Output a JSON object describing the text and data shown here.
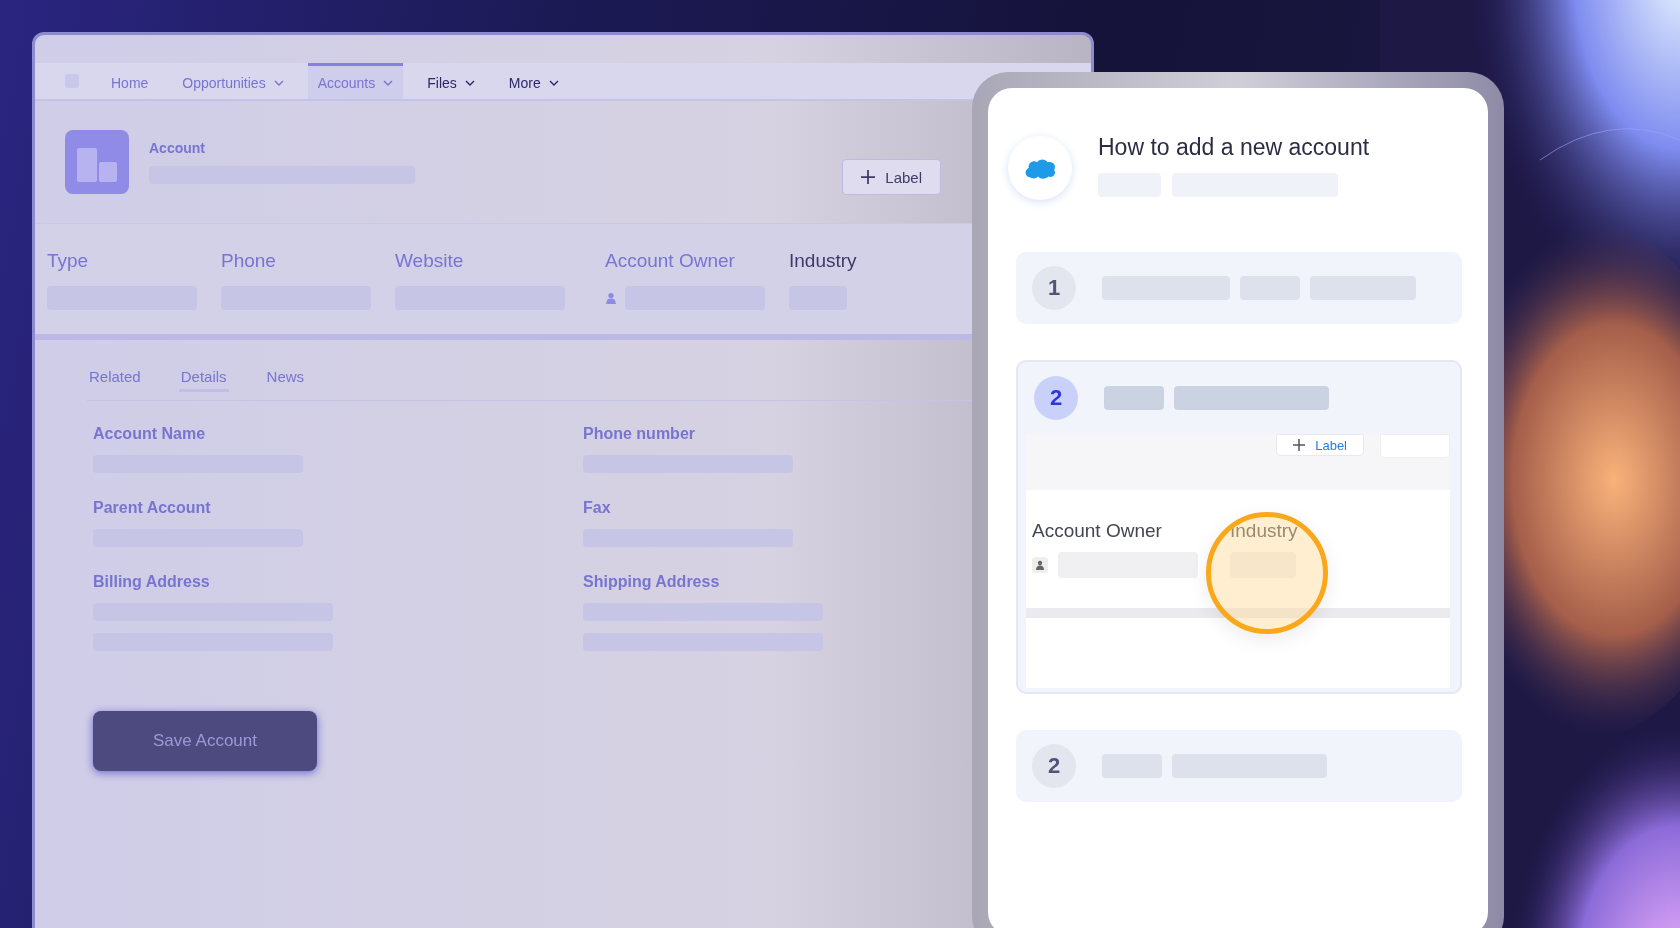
{
  "app_window": {
    "nav_tabs": [
      {
        "label": "Home",
        "selected": false,
        "dropdown": false,
        "faded": true
      },
      {
        "label": "Opportunities",
        "selected": false,
        "dropdown": true,
        "faded": true
      },
      {
        "label": "Accounts",
        "selected": true,
        "dropdown": true,
        "faded": true
      },
      {
        "label": "Files",
        "selected": false,
        "dropdown": true,
        "faded": false
      },
      {
        "label": "More",
        "selected": false,
        "dropdown": true,
        "faded": false
      }
    ],
    "record_type": "Account",
    "header_button": "Label",
    "highlight_fields": [
      {
        "label": "Type",
        "kind": "text",
        "faded": true
      },
      {
        "label": "Phone",
        "kind": "text",
        "faded": true
      },
      {
        "label": "Website",
        "kind": "text",
        "faded": true
      },
      {
        "label": "Account Owner",
        "kind": "user",
        "faded": true
      },
      {
        "label": "Industry",
        "kind": "short",
        "faded": false
      }
    ],
    "detail_tabs": [
      {
        "label": "Related",
        "selected": false
      },
      {
        "label": "Details",
        "selected": true
      },
      {
        "label": "News",
        "selected": false
      }
    ],
    "detail_fields": [
      {
        "label": "Account Name",
        "kind": "single"
      },
      {
        "label": "Phone number",
        "kind": "single"
      },
      {
        "label": "Parent Account",
        "kind": "single"
      },
      {
        "label": "Fax",
        "kind": "single"
      },
      {
        "label": "Billing Address",
        "kind": "address"
      },
      {
        "label": "Shipping Address",
        "kind": "address"
      }
    ],
    "save_button": "Save Account"
  },
  "guide": {
    "title": "How to add a new account",
    "steps": [
      {
        "number": "1",
        "selected": false,
        "expanded": false
      },
      {
        "number": "2",
        "selected": true,
        "expanded": true
      },
      {
        "number": "2",
        "selected": false,
        "expanded": false
      }
    ],
    "preview": {
      "button": "Label",
      "fields": [
        "Account Owner",
        "Industry"
      ]
    }
  }
}
